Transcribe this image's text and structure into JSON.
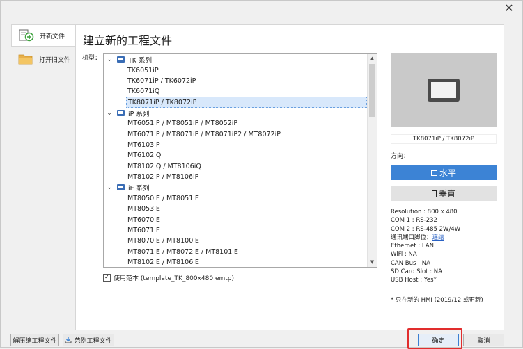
{
  "nav": {
    "items": [
      {
        "label": "开新文件",
        "active": true,
        "icon": "new-file-icon"
      },
      {
        "label": "打开旧文件",
        "active": false,
        "icon": "folder-icon"
      }
    ]
  },
  "panel": {
    "title": "建立新的工程文件",
    "model_label": "机型："
  },
  "tree": {
    "groups": [
      {
        "label": "TK 系列",
        "items": [
          "TK6051iP",
          "TK6071iP / TK6072iP",
          "TK6071iQ",
          "TK8071iP / TK8072iP"
        ]
      },
      {
        "label": "iP 系列",
        "items": [
          "MT6051iP / MT8051iP / MT8052iP",
          "MT6071iP / MT8071iP / MT8071iP2 / MT8072iP",
          "MT6103iP",
          "MT6102iQ",
          "MT8102iQ / MT8106iQ",
          "MT8102iP / MT8106iP"
        ]
      },
      {
        "label": "iE 系列",
        "items": [
          "MT8050iE / MT8051iE",
          "MT8053iE",
          "MT6070iE",
          "MT6071iE",
          "MT8070iE / MT8100iE",
          "MT8071iE / MT8072iE / MT8101iE",
          "MT8102iE / MT8106iE"
        ]
      }
    ],
    "selected": "TK8071iP / TK8072iP"
  },
  "template": {
    "checked": true,
    "label": "使用范本 (template_TK_800x480.emtp)"
  },
  "preview": {
    "name": "TK8071iP / TK8072iP"
  },
  "orientation": {
    "label": "方向：",
    "horizontal": "水平",
    "vertical": "垂直",
    "active": "horizontal"
  },
  "specs": {
    "resolution": "Resolution : 800 x 480",
    "com1": "COM 1 : RS-232",
    "com2": "COM 2 : RS-485 2W/4W",
    "pinout_prefix": "通讯端口脚位：",
    "pinout_link": "连结",
    "ethernet": "Ethernet : LAN",
    "wifi": "WiFi : NA",
    "canbus": "CAN Bus : NA",
    "sdcard": "SD Card Slot : NA",
    "usbhost": "USB Host : Yes*"
  },
  "note": "* 只在新的 HMI (2019/12 或更新)",
  "footer": {
    "unzip": "解压缩工程文件",
    "samples": "范例工程文件",
    "ok": "确定",
    "cancel": "取消"
  },
  "colors": {
    "accent": "#3c83d5",
    "highlight_box": "#e12d2d",
    "link": "#2a62c4"
  }
}
